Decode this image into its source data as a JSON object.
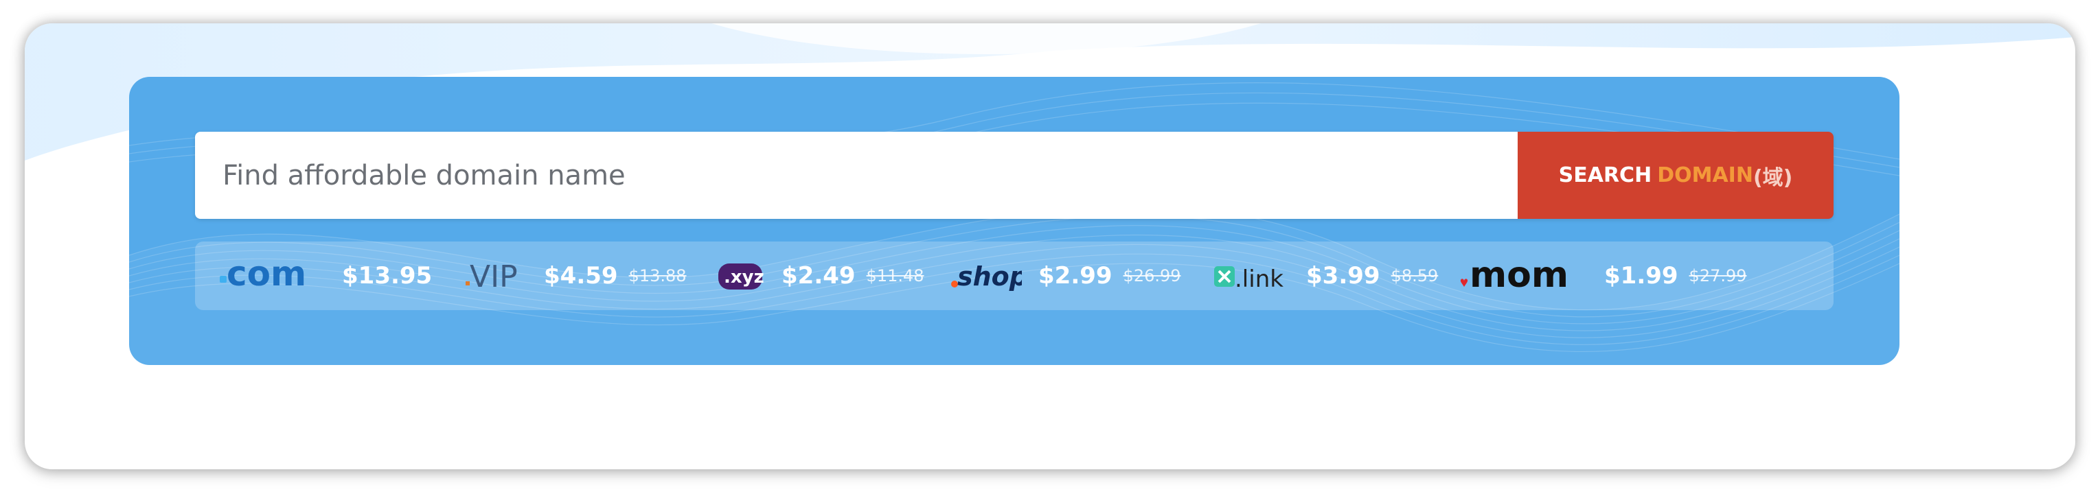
{
  "search": {
    "placeholder": "Find affordable domain name",
    "button_word1": "SEARCH",
    "button_word2": "DOMAIN",
    "button_word3": "(域)"
  },
  "tlds": [
    {
      "label": ".com",
      "price": "$13.95",
      "old_price": ""
    },
    {
      "label": ".VIP",
      "price": "$4.59",
      "old_price": "$13.88"
    },
    {
      "label": ".xyz",
      "price": "$2.49",
      "old_price": "$11.48"
    },
    {
      "label": ".shop",
      "price": "$2.99",
      "old_price": "$26.99"
    },
    {
      "label": ".link",
      "price": "$3.99",
      "old_price": "$8.59"
    },
    {
      "label": ".mom",
      "price": "$1.99",
      "old_price": "$27.99"
    }
  ],
  "colors": {
    "panel": "#55aaea",
    "button": "#d0412e",
    "button_accent": "#f39a3a"
  }
}
